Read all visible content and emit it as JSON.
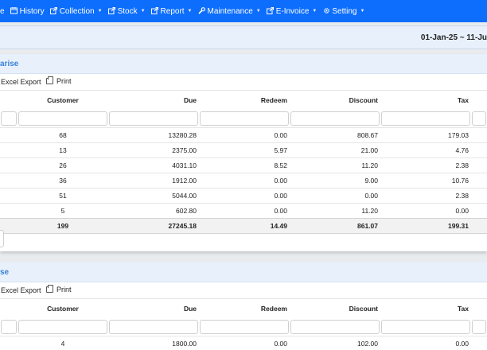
{
  "nav": {
    "items": [
      {
        "label": "e",
        "icon": "",
        "caret": false
      },
      {
        "label": "History",
        "icon": "history-icon",
        "caret": false
      },
      {
        "label": "Collection",
        "icon": "external-link-icon",
        "caret": true
      },
      {
        "label": "Stock",
        "icon": "external-link-icon",
        "caret": true
      },
      {
        "label": "Report",
        "icon": "external-link-icon",
        "caret": true
      },
      {
        "label": "Maintenance",
        "icon": "wrench-icon",
        "caret": true
      },
      {
        "label": "E-Invoice",
        "icon": "external-link-icon",
        "caret": true
      },
      {
        "label": "Setting",
        "icon": "gear-icon",
        "caret": true
      }
    ]
  },
  "date_range": "01-Jan-25 ~ 11-Ju",
  "panels": [
    {
      "title": "arise",
      "excel_label": "Excel Export",
      "print_label": "Print",
      "columns": [
        "Customer",
        "Due",
        "Redeem",
        "Discount",
        "Tax"
      ],
      "rows": [
        [
          "68",
          "13280.28",
          "0.00",
          "808.67",
          "179.03"
        ],
        [
          "13",
          "2375.00",
          "5.97",
          "21.00",
          "4.76"
        ],
        [
          "26",
          "4031.10",
          "8.52",
          "11.20",
          "2.38"
        ],
        [
          "36",
          "1912.00",
          "0.00",
          "9.00",
          "10.76"
        ],
        [
          "51",
          "5044.00",
          "0.00",
          "0.00",
          "2.38"
        ],
        [
          "5",
          "602.80",
          "0.00",
          "11.20",
          "0.00"
        ]
      ],
      "total": [
        "199",
        "27245.18",
        "14.49",
        "861.07",
        "199.31"
      ]
    },
    {
      "title": "se",
      "excel_label": "Excel Export",
      "print_label": "Print",
      "columns": [
        "Customer",
        "Due",
        "Redeem",
        "Discount",
        "Tax"
      ],
      "rows": [
        [
          "4",
          "1800.00",
          "0.00",
          "102.00",
          "0.00"
        ]
      ]
    }
  ],
  "colors": {
    "nav_bg": "#0d6efd",
    "panel_title": "#3b82d6",
    "header_bg": "#e7f0fb"
  }
}
